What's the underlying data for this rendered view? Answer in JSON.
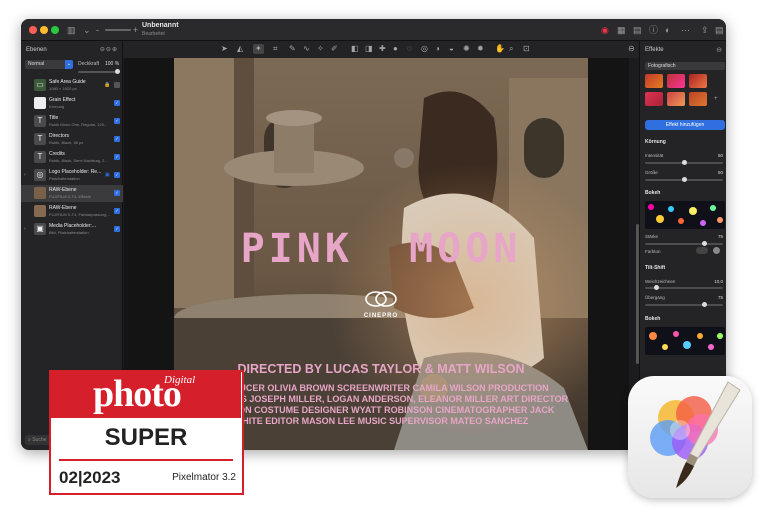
{
  "document": {
    "title": "Unbenannt",
    "subtitle": "Bearbeitet"
  },
  "layers_panel": {
    "title": "Ebenen",
    "blend_mode": "Normal",
    "opacity_label": "Deckkraft",
    "opacity_value": "100 %",
    "search_placeholder": "Suche",
    "layers": [
      {
        "name": "Safe Area Guide",
        "sub": "1080 × 1920 px",
        "thumb": "▭"
      },
      {
        "name": "Grain Effect",
        "sub": "Körnung",
        "thumb": ""
      },
      {
        "name": "Title",
        "sub": "Rubik Mono One, Regular, 120...",
        "thumb": "T"
      },
      {
        "name": "Directors",
        "sub": "Rubik, Black, 46 px",
        "thumb": "T"
      },
      {
        "name": "Credits",
        "sub": "Rubik, Black, Semi Nachtrag, 2...",
        "thumb": "T"
      },
      {
        "name": "Logo Placeholder: Re...",
        "sub": "Platzhalterstation",
        "thumb": "◎"
      },
      {
        "name": "RAW-Ebene",
        "sub": "FUJIFILM X-T4, Effekte",
        "thumb": ""
      },
      {
        "name": "RAW-Ebene",
        "sub": "FUJIFILM X-T4, Farbanpassung...",
        "thumb": ""
      },
      {
        "name": "Media Placeholder:...",
        "sub": "Bild, Platzhalterstation",
        "thumb": "▣"
      }
    ]
  },
  "poster": {
    "title": "PINK  MOON",
    "logo": "CINEPRO",
    "directed": "DIRECTED BY LUCAS TAYLOR & MATT WILSON",
    "credits_line1": "PRODUCER OLIVIA BROWN SCREENWRITER CAMILA WILSON PRODUCTION",
    "credits_line2": "DESIGNERS JOSEPH MILLER, LOGAN ANDERSON, ELEANOR MILLER ART DIRECTOR",
    "credits_line3": "JACKSON COSTUME DESIGNER WYATT ROBINSON CINEMATOGRAPHER JACK",
    "credits_line4": "WHITE EDITOR MASON LEE MUSIC SUPERVISOR MATEO SANCHEZ"
  },
  "effects_panel": {
    "title": "Effekte",
    "category": "Fotografisch",
    "add_button": "Effekt hinzufügen",
    "grain": {
      "title": "Körnung",
      "intensity_label": "Intensität",
      "intensity_value": "50",
      "size_label": "Größe",
      "size_value": "50"
    },
    "bokeh1": {
      "title": "Bokeh",
      "strength_label": "Stärke",
      "strength_value": "75",
      "color_label": "Farbton"
    },
    "tilt": {
      "title": "Tilt-Shift",
      "blur_label": "Weichzeichnen",
      "blur_value": "10,0",
      "transition_label": "Übergang",
      "transition_value": "75"
    },
    "bokeh2": {
      "title": "Bokeh"
    }
  },
  "badge": {
    "digital": "Digital",
    "brand": "photo",
    "rating": "SUPER",
    "date": "02|2023",
    "app": "Pixelmator 3.2"
  },
  "colors": {
    "accent": "#2f6fe0",
    "badge_red": "#d51f2b",
    "poster_pink": "#e7a6c7"
  }
}
